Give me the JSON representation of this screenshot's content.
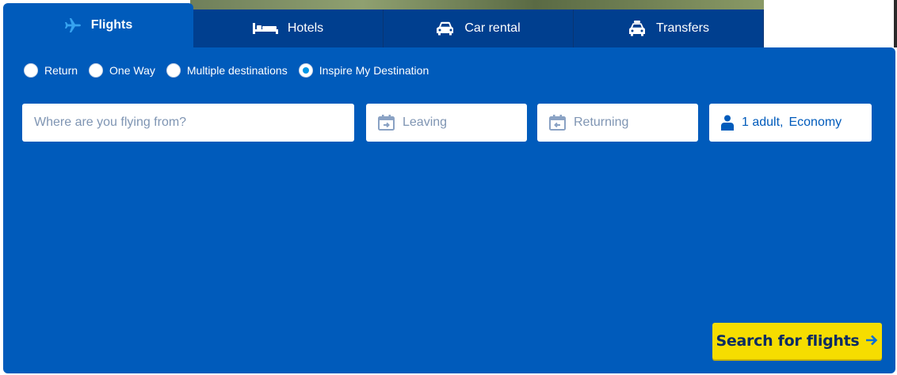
{
  "tabs": [
    {
      "label": "Flights",
      "icon": "plane-icon",
      "active": true
    },
    {
      "label": "Hotels",
      "icon": "bed-icon",
      "active": false
    },
    {
      "label": "Car rental",
      "icon": "car-icon",
      "active": false
    },
    {
      "label": "Transfers",
      "icon": "taxi-icon",
      "active": false
    }
  ],
  "trip_type": {
    "options": [
      "Return",
      "One Way",
      "Multiple destinations",
      "Inspire My Destination"
    ],
    "selected": "Inspire My Destination"
  },
  "search": {
    "from_placeholder": "Where are you flying from?",
    "leaving_placeholder": "Leaving",
    "returning_placeholder": "Returning",
    "passengers": "1 adult,",
    "cabin_class": "Economy",
    "submit_label": "Search for flights"
  },
  "colors": {
    "panel": "#005bbb",
    "tab_inactive": "#003f8f",
    "button": "#f6dd00",
    "button_text": "#0b2c63",
    "radio_selected": "#0096e6"
  }
}
